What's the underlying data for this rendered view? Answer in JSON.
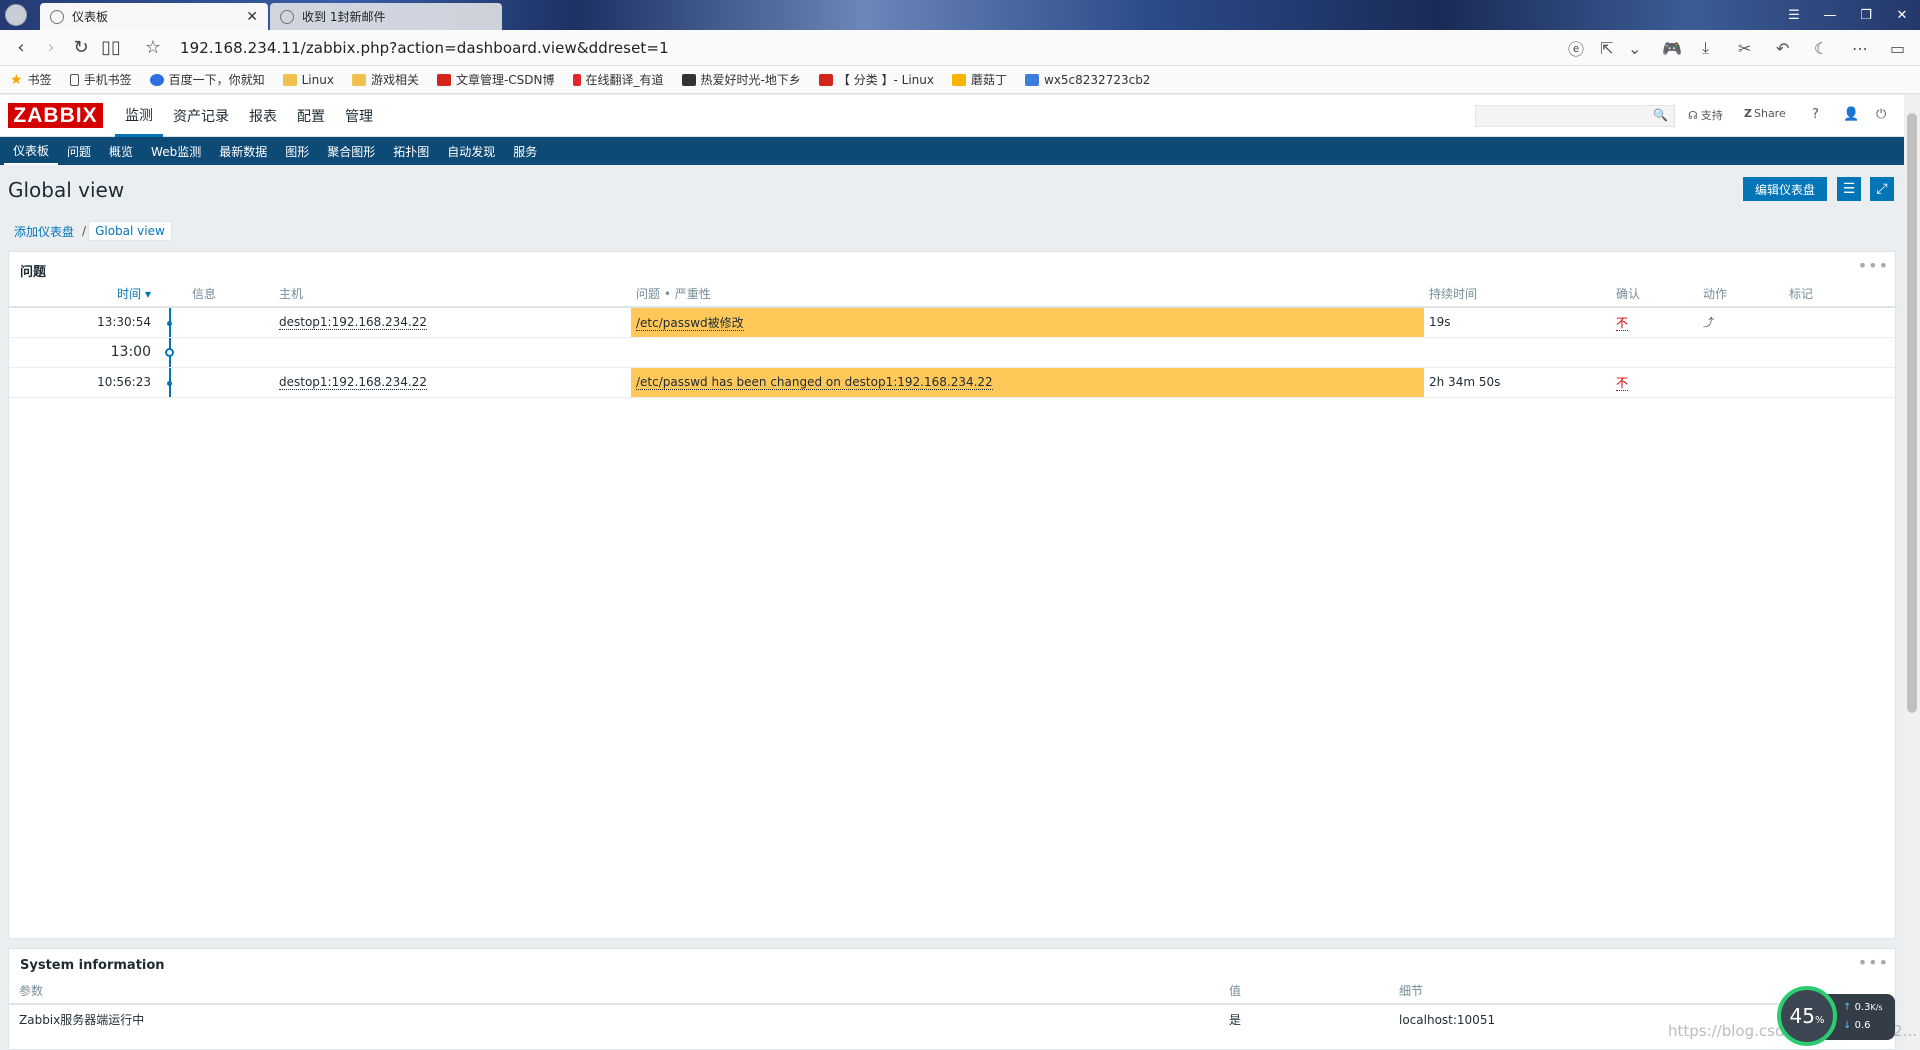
{
  "browser": {
    "tabs": [
      {
        "label": "仪表板",
        "active": true
      },
      {
        "label": "收到 1封新邮件",
        "active": false
      }
    ],
    "url": "192.168.234.11/zabbix.php?action=dashboard.view&ddreset=1",
    "bookmarks": [
      "书签",
      "手机书签",
      "百度一下，你就知",
      "Linux",
      "游戏相关",
      "文章管理-CSDN博",
      "在线翻译_有道",
      "热爱好时光-地下乡",
      "【 分类 】- Linux",
      "蘑菇丁",
      "wx5c8232723cb2"
    ]
  },
  "header": {
    "logo": "ZABBIX",
    "menu": [
      "监测",
      "资产记录",
      "报表",
      "配置",
      "管理"
    ],
    "active_menu": "监测",
    "support": "支持",
    "share": "Share",
    "help": "?"
  },
  "submenu": [
    "仪表板",
    "问题",
    "概览",
    "Web监测",
    "最新数据",
    "图形",
    "聚合图形",
    "拓扑图",
    "自动发现",
    "服务"
  ],
  "page": {
    "title": "Global view",
    "edit_button": "编辑仪表盘",
    "breadcrumb": {
      "parent": "添加仪表盘",
      "separator": "/",
      "current": "Global view"
    }
  },
  "problems": {
    "title": "问题",
    "columns": [
      "时间 ▾",
      "信息",
      "主机",
      "问题 • 严重性",
      "持续时间",
      "确认",
      "动作",
      "标记"
    ],
    "rows": [
      {
        "time": "13:30:54",
        "host": "destop1:192.168.234.22",
        "problem": "/etc/passwd被修改",
        "duration": "19s",
        "ack": "不",
        "action": "⤴"
      },
      {
        "separator": "13:00"
      },
      {
        "time": "10:56:23",
        "host": "destop1:192.168.234.22",
        "problem": "/etc/passwd has been changed on destop1:192.168.234.22",
        "duration": "2h 34m 50s",
        "ack": "不",
        "action": ""
      }
    ],
    "severity_color": "#ffc859"
  },
  "sysinfo": {
    "title": "System information",
    "columns": [
      "参数",
      "值",
      "细节"
    ],
    "rows": [
      {
        "param": "Zabbix服务器端运行中",
        "value": "是",
        "detail": "localhost:10051"
      }
    ]
  },
  "netmon": {
    "percent": "45",
    "percent_unit": "%",
    "up": "0.3",
    "up_unit": "K/s",
    "down": "0.6"
  },
  "watermark": "https://blog.csdn.net/qq_41852..."
}
